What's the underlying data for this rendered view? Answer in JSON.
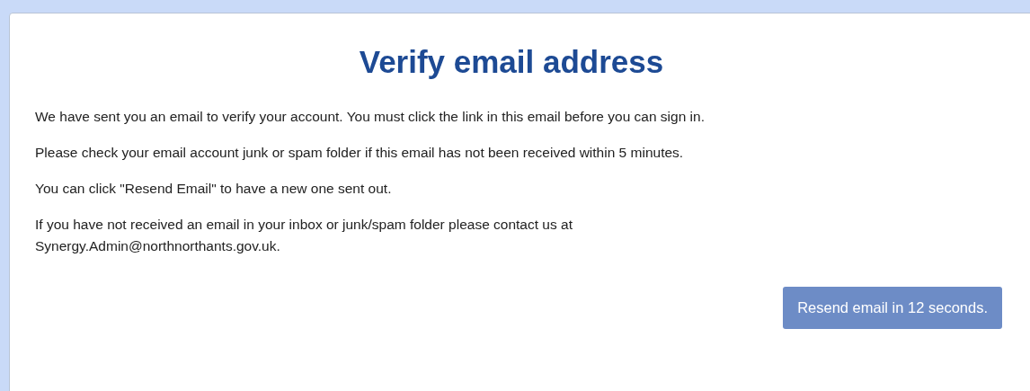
{
  "title": "Verify email address",
  "paragraphs": [
    "We have sent you an email to verify your account. You must click the link in this email before you can sign in.",
    "Please check your email account junk or spam folder if this email has not been received within 5 minutes.",
    "You can click \"Resend Email\" to have a new one sent out.",
    "If you have not received an email in your inbox or junk/spam folder please contact us at Synergy.Admin@northnorthants.gov.uk."
  ],
  "button": {
    "label": "Resend email in 12 seconds.",
    "disabled": true
  }
}
